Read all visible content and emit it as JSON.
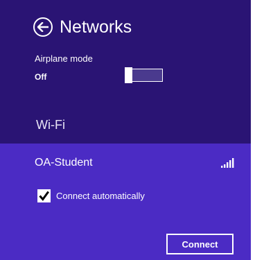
{
  "header": {
    "title": "Networks",
    "back_icon": "back-arrow-icon"
  },
  "airplane_mode": {
    "label": "Airplane mode",
    "state": "Off",
    "on": false
  },
  "wifi": {
    "section_title": "Wi-Fi",
    "networks": [
      {
        "name": "OA-Student",
        "signal_icon": "signal-strength-icon",
        "signal_bars": 5,
        "connect_automatically": {
          "label": "Connect automatically",
          "checked": true
        },
        "connect_button": "Connect"
      }
    ]
  },
  "colors": {
    "header_bg": "#2a1474",
    "selected_bg": "#4b2bc4",
    "text": "#ffffff"
  }
}
